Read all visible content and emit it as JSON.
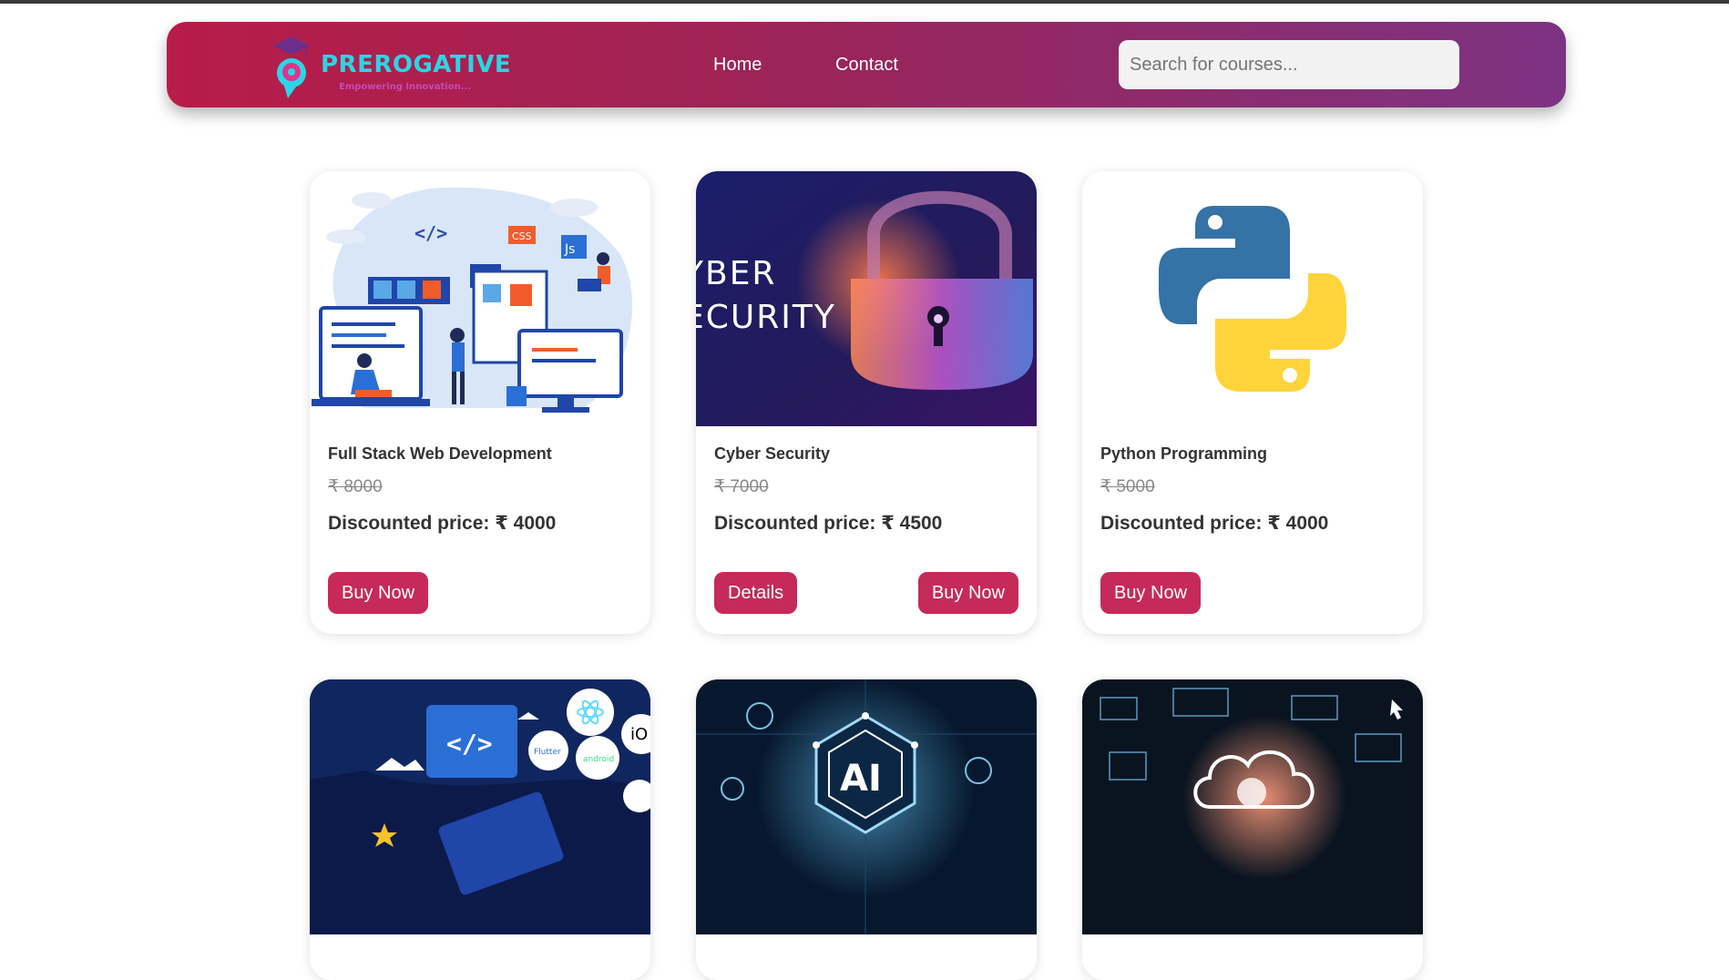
{
  "brand": {
    "name": "PREROGATIVE",
    "tagline": "Empowering Innovation..."
  },
  "nav": {
    "links": [
      {
        "label": "Home"
      },
      {
        "label": "Contact"
      }
    ],
    "search": {
      "placeholder": "Search for courses...",
      "value": ""
    }
  },
  "colors": {
    "accent_button": "#c62a5a",
    "navbar_gradient_start": "#b81c48",
    "navbar_gradient_end": "#7d3383",
    "logo_text": "#2ad6e6"
  },
  "courses": [
    {
      "image": "web-development-illustration",
      "title": "Full Stack Web Development",
      "original_price": "₹ 8000",
      "discounted_price": "Discounted price: ₹ 4000",
      "buttons": [
        "Buy Now"
      ]
    },
    {
      "image": "cyber-security-padlock",
      "image_text": "CYBER SECURITY",
      "title": "Cyber Security",
      "original_price": "₹ 7000",
      "discounted_price": "Discounted price: ₹ 4500",
      "buttons": [
        "Details",
        "Buy Now"
      ]
    },
    {
      "image": "python-logo",
      "title": "Python Programming",
      "original_price": "₹ 5000",
      "discounted_price": "Discounted price: ₹ 4000",
      "buttons": [
        "Buy Now"
      ]
    },
    {
      "image": "app-development-illustration",
      "image_labels": [
        "</>",
        "android",
        "Flutter",
        "iO"
      ]
    },
    {
      "image": "artificial-intelligence-chip",
      "image_labels": [
        "AI"
      ]
    },
    {
      "image": "cloud-computing-network"
    }
  ]
}
